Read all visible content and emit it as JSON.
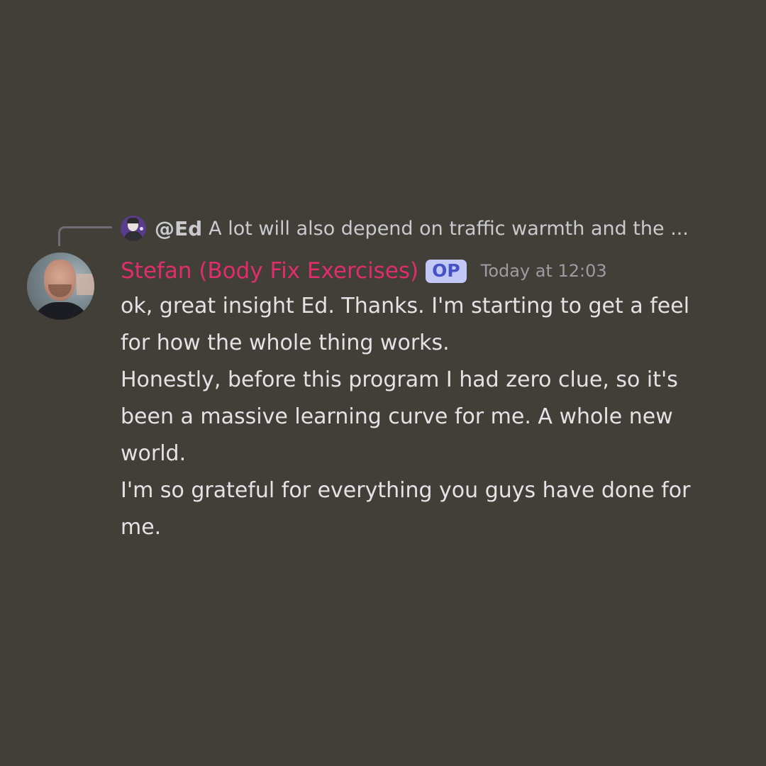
{
  "reply": {
    "mention": "@Ed",
    "preview": "A lot will also depend on traffic warmth and the ...",
    "avatar_icon": "user-avatar-icon"
  },
  "message": {
    "author": "Stefan (Body Fix Exercises)",
    "badge": "OP",
    "timestamp": "Today at 12:03",
    "paragraphs": [
      "ok, great insight Ed. Thanks. I'm starting to get a feel for how the whole thing works.",
      "Honestly, before this program I had zero clue, so it's been a massive learning curve for me. A whole new world.",
      "I'm so grateful for everything you guys have done for me."
    ]
  },
  "colors": {
    "background": "#423e38",
    "author_name": "#e12d6e",
    "badge_bg": "#c3c8f7",
    "badge_text": "#4452c4",
    "timestamp": "#9c9ca2",
    "body_text": "#e3e3e6",
    "reply_text": "#c9cace"
  }
}
